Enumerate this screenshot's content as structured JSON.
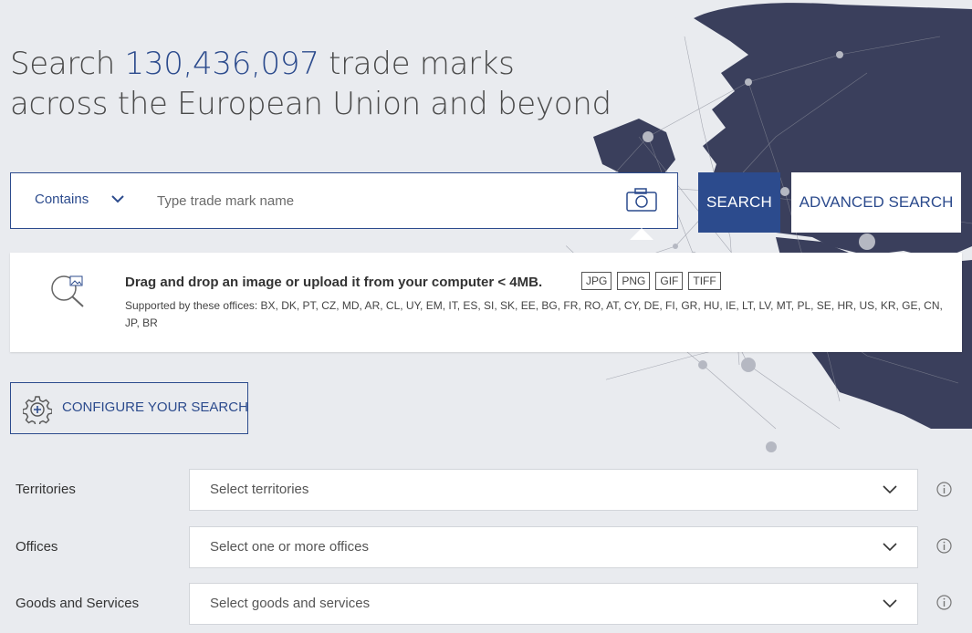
{
  "headline": {
    "prefix": "Search",
    "count": "130,436,097",
    "suffix": "trade marks",
    "line2": "across the European Union and beyond"
  },
  "search": {
    "mode_label": "Contains",
    "placeholder": "Type trade mark name",
    "search_label": "SEARCH",
    "advanced_label": "ADVANCED SEARCH"
  },
  "upload": {
    "title": "Drag and drop an image or upload it from your computer < 4MB.",
    "formats": [
      "JPG",
      "PNG",
      "GIF",
      "TIFF"
    ],
    "offices_text": "Supported by these offices: BX, DK, PT, CZ, MD, AR, CL, UY, EM, IT, ES, SI, SK, EE, BG, FR, RO, AT, CY, DE, FI, GR, HU, IE, LT, LV, MT, PL, SE, HR, US, KR, GE, CN, JP, BR"
  },
  "configure": {
    "label": "CONFIGURE YOUR SEARCH"
  },
  "filters": [
    {
      "label": "Territories",
      "placeholder": "Select territories"
    },
    {
      "label": "Offices",
      "placeholder": "Select one or more offices"
    },
    {
      "label": "Goods and Services",
      "placeholder": "Select goods and services"
    }
  ],
  "colors": {
    "primary": "#2c4b8d",
    "background": "#e9ebef",
    "globe": "#3a3f5c"
  }
}
